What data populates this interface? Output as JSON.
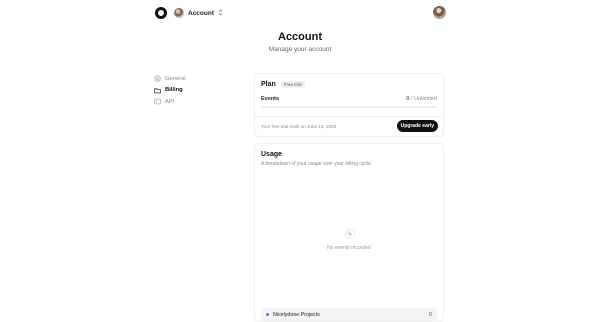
{
  "header": {
    "account_label": "Account",
    "account_chevron": "⌃⌄"
  },
  "page": {
    "title": "Account",
    "subtitle": "Manage your account"
  },
  "sidebar": {
    "items": [
      {
        "label": "General",
        "icon": "settings-icon",
        "active": false
      },
      {
        "label": "Billing",
        "icon": "folder-icon",
        "active": true
      },
      {
        "label": "API",
        "icon": "terminal-icon",
        "active": false
      }
    ]
  },
  "plan": {
    "title": "Plan",
    "badge": "Free trial",
    "events_label": "Events",
    "events_used": "0",
    "events_limit": " / Unlimited",
    "usage_fraction": 0,
    "trial_text": "Your free trial ends on June 13, 2026",
    "upgrade_label": "Upgrade early"
  },
  "usage": {
    "title": "Usage",
    "subtitle": "A breakdown of your usage over your billing cycle",
    "empty_text": "No events recorded",
    "empty_icon": "cursor-click-icon",
    "projects": [
      {
        "name": "Nicelydone Projects",
        "count": "0",
        "dot_color": "#4a7cf0"
      }
    ]
  },
  "colors": {
    "accent": "#111111",
    "project_dot": "#4a7cf0"
  }
}
